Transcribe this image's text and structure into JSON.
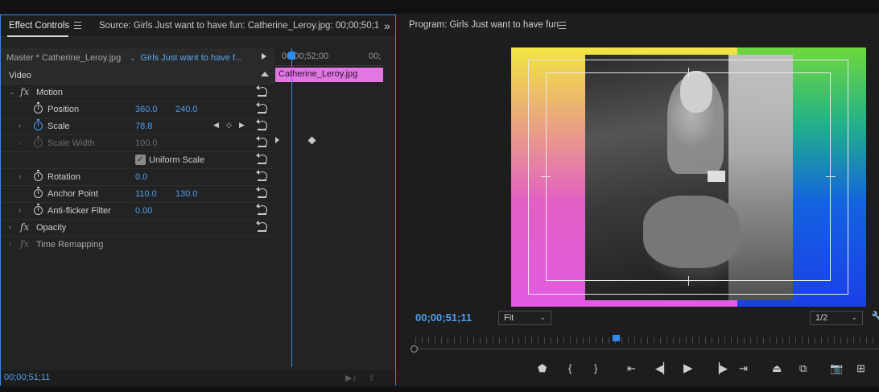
{
  "effect_controls": {
    "tab_label": "Effect Controls",
    "source_tab": "Source: Girls Just want to have fun: Catherine_Leroy.jpg: 00;00;50;1",
    "overflow_icon": "double-chevron-right-icon",
    "master_label": "Master * Catherine_Leroy.jpg",
    "sequence_label": "Girls Just want to have f...",
    "section_video": "Video",
    "effects": {
      "motion": "Motion",
      "opacity": "Opacity",
      "time_remapping": "Time Remapping"
    },
    "properties": {
      "position": {
        "label": "Position",
        "x": "360.0",
        "y": "240.0"
      },
      "scale": {
        "label": "Scale",
        "value": "78.8"
      },
      "scale_width": {
        "label": "Scale Width",
        "value": "100.0"
      },
      "uniform_scale": {
        "label": "Uniform Scale",
        "checked": true
      },
      "rotation": {
        "label": "Rotation",
        "value": "0.0"
      },
      "anchor_point": {
        "label": "Anchor Point",
        "x": "110.0",
        "y": "130.0"
      },
      "anti_flicker": {
        "label": "Anti-flicker Filter",
        "value": "0.00"
      }
    },
    "timeline": {
      "time_label": "00;00;52;00",
      "time_label_right": "00;",
      "clip_name": "Catherine_Leroy.jpg"
    },
    "footer_timecode": "00;00;51;11"
  },
  "program_monitor": {
    "title": "Program: Girls Just want to have fun",
    "timecode": "00;00;51;11",
    "zoom": "Fit",
    "resolution": "1/2"
  },
  "colors": {
    "accent_blue": "#2d8ceb",
    "value_blue": "#4c9ff0",
    "clip_pink": "#e178e2"
  }
}
